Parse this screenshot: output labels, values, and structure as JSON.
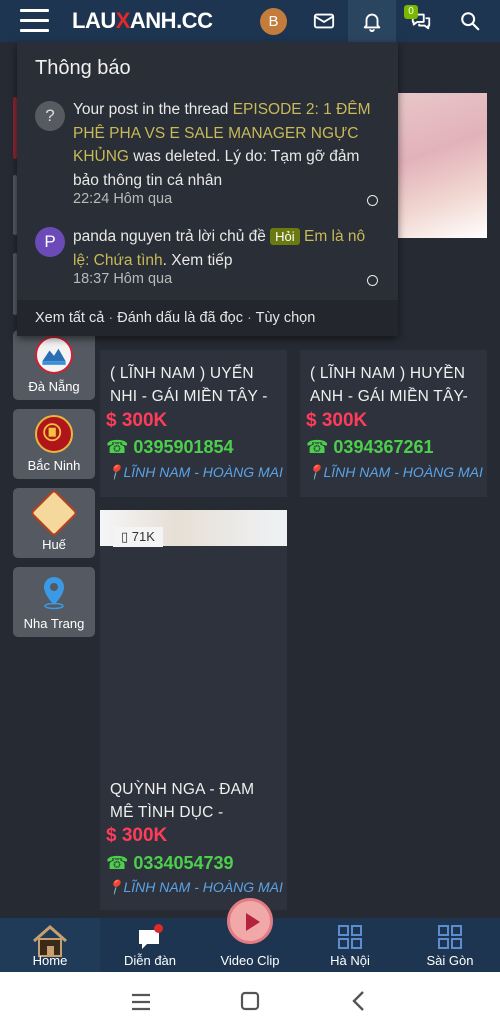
{
  "header": {
    "logo_part1": "LAU",
    "logo_part2": "X",
    "logo_part3": "ANH.CC",
    "avatar_letter": "B",
    "conversations_badge": "0"
  },
  "notifications": {
    "title": "Thông báo",
    "items": [
      {
        "icon": "?",
        "text_before": "Your post in the thread ",
        "link_text": "EPISODE 2: 1 ĐÊM PHÊ PHA VS E SALE MANAGER NGỰC KHỦNG",
        "text_after": " was deleted. Lý do: Tạm gỡ đảm bảo thông tin cá nhân",
        "time": "22:24 Hôm qua"
      },
      {
        "icon": "P",
        "user": "panda nguyen",
        "text_before": " trả lời chủ đề ",
        "tag": "Hỏi",
        "link_text": "Em là nô lệ: Chứa tình",
        "text_after": ". Xem tiếp",
        "time": "18:37 Hôm qua"
      }
    ],
    "footer": {
      "view_all": "Xem tất cả",
      "sep": "·",
      "mark_read": "Đánh dấu là đã đọc",
      "options": "Tùy chọn"
    }
  },
  "sidebar": {
    "cities": [
      {
        "label": "Đà Nẵng"
      },
      {
        "label": "Bắc Ninh"
      },
      {
        "label": "Huế"
      },
      {
        "label": "Nha Trang"
      }
    ]
  },
  "listings": [
    {
      "title_line1": "( LĨNH NAM ) UYỂN",
      "title_line2": "NHI - GÁI MIỀN TÂY -",
      "price": "$ 300K",
      "phone": "☎ 0395901854",
      "location": "LĨNH NAM - HOÀNG MAI"
    },
    {
      "title_line1": "( LĨNH NAM ) HUYỀN",
      "title_line2": "ANH - GÁI MIỀN TÂY-",
      "price": "$ 300K",
      "phone": "☎ 0394367261",
      "location": "LĨNH NAM - HOÀNG MAI"
    },
    {
      "views": "71K",
      "title_line1": "QUỲNH NGA - ĐAM",
      "title_line2": "MÊ TÌNH DỤC -",
      "price": "$ 300K",
      "phone": "☎ 0334054739",
      "location": "LĨNH NAM - HOÀNG MAI"
    }
  ],
  "bottom_nav": {
    "items": [
      {
        "label": "Home"
      },
      {
        "label": "Diễn đàn"
      },
      {
        "label": "Video Clip"
      },
      {
        "label": "Hà Nội"
      },
      {
        "label": "Sài Gòn"
      }
    ]
  },
  "colors": {
    "header_bg": "#1d3550",
    "price_red": "#ff3c5a",
    "phone_green": "#4ccf4c",
    "location_blue": "#5aa3e8",
    "link_gold": "#c8b95a"
  }
}
